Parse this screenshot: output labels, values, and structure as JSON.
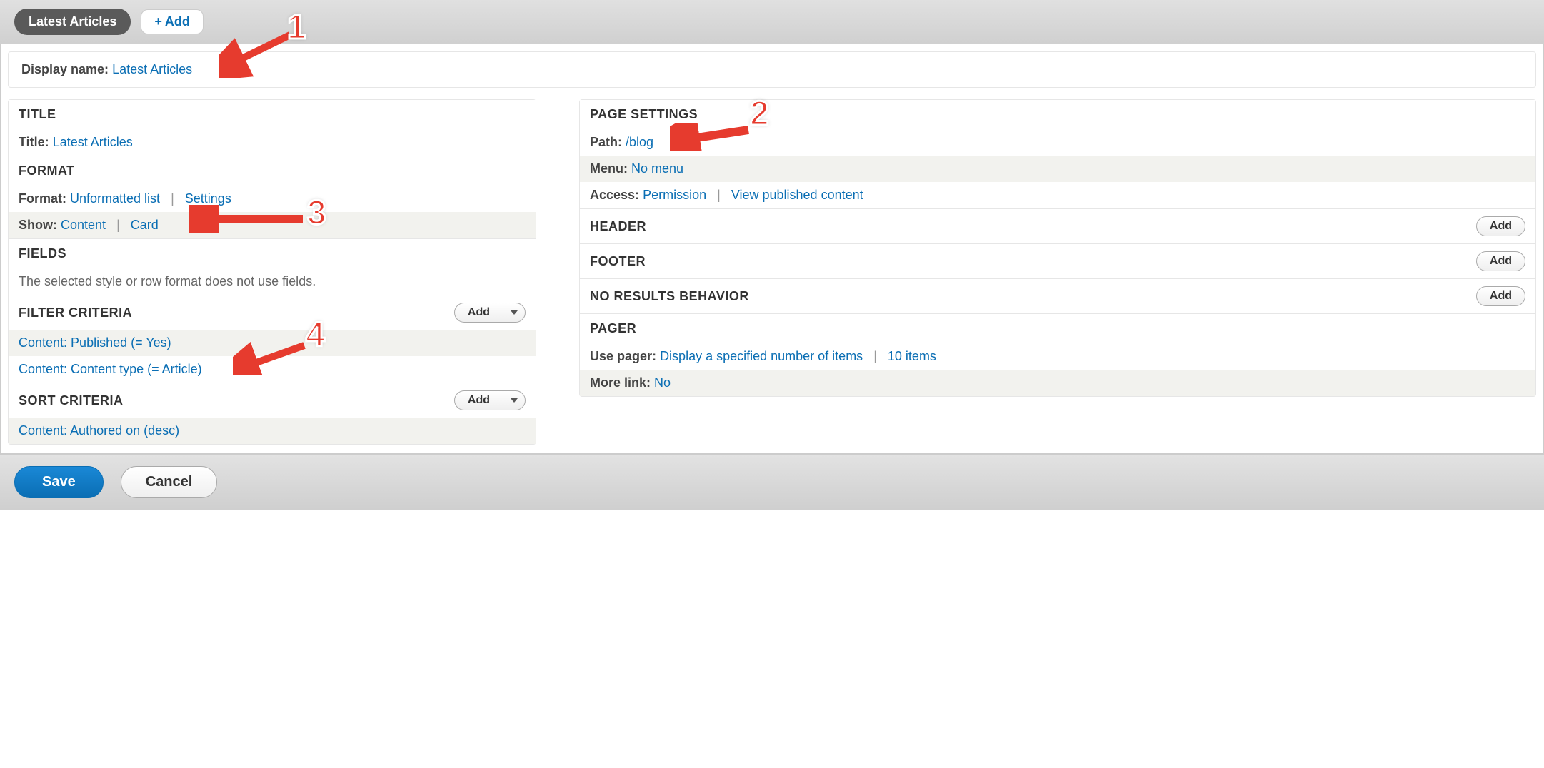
{
  "topbar": {
    "tab_label": "Latest Articles",
    "add_label": "Add"
  },
  "display_name": {
    "label": "Display name:",
    "value": "Latest Articles"
  },
  "left": {
    "title_section": {
      "heading": "TITLE",
      "label": "Title:",
      "value": "Latest Articles"
    },
    "format_section": {
      "heading": "FORMAT",
      "format_label": "Format:",
      "format_value": "Unformatted list",
      "settings": "Settings",
      "show_label": "Show:",
      "show_value": "Content",
      "show_link2": "Card"
    },
    "fields_section": {
      "heading": "FIELDS",
      "help": "The selected style or row format does not use fields."
    },
    "filter_section": {
      "heading": "FILTER CRITERIA",
      "add": "Add",
      "item1": "Content: Published (= Yes)",
      "item2": "Content: Content type (= Article)"
    },
    "sort_section": {
      "heading": "SORT CRITERIA",
      "add": "Add",
      "item1": "Content: Authored on (desc)"
    }
  },
  "right": {
    "page_settings": {
      "heading": "PAGE SETTINGS",
      "path_label": "Path:",
      "path_value": "/blog",
      "menu_label": "Menu:",
      "menu_value": "No menu",
      "access_label": "Access:",
      "access_value": "Permission",
      "access_link2": "View published content"
    },
    "header_section": {
      "heading": "HEADER",
      "add": "Add"
    },
    "footer_section": {
      "heading": "FOOTER",
      "add": "Add"
    },
    "noresults_section": {
      "heading": "NO RESULTS BEHAVIOR",
      "add": "Add"
    },
    "pager_section": {
      "heading": "PAGER",
      "pager_label": "Use pager:",
      "pager_value": "Display a specified number of items",
      "pager_count": "10 items",
      "morelink_label": "More link:",
      "morelink_value": "No"
    }
  },
  "bottom": {
    "save": "Save",
    "cancel": "Cancel"
  },
  "annotations": {
    "n1": "1",
    "n2": "2",
    "n3": "3",
    "n4": "4"
  }
}
